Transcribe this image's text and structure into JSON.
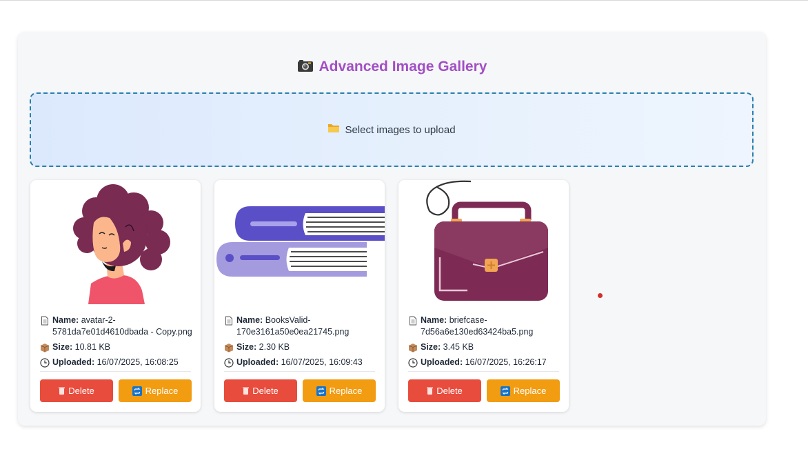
{
  "gallery": {
    "title": "Advanced Image Gallery",
    "upload_label": "Select images to upload"
  },
  "labels": {
    "name": "Name:",
    "size": "Size:",
    "uploaded": "Uploaded:",
    "delete": "Delete",
    "replace": "Replace"
  },
  "images": [
    {
      "name": "avatar-2-5781da7e01d4610dbada - Copy.png",
      "size": "10.81 KB",
      "uploaded": "16/07/2025, 16:08:25"
    },
    {
      "name": "BooksValid-170e3161a50e0ea21745.png",
      "size": "2.30 KB",
      "uploaded": "16/07/2025, 16:09:43"
    },
    {
      "name": "briefcase-7d56a6e130ed63424ba5.png",
      "size": "3.45 KB",
      "uploaded": "16/07/2025, 16:26:17"
    }
  ],
  "colors": {
    "title": "#a24fc4",
    "upload_border": "#2a7fad",
    "delete": "#e84c3d",
    "replace": "#f29c12"
  },
  "icons": {
    "title": "camera-icon",
    "upload": "folder-icon",
    "name": "document-icon",
    "size": "box-icon",
    "uploaded": "clock-icon",
    "delete": "trash-icon",
    "replace": "repeat-icon"
  }
}
